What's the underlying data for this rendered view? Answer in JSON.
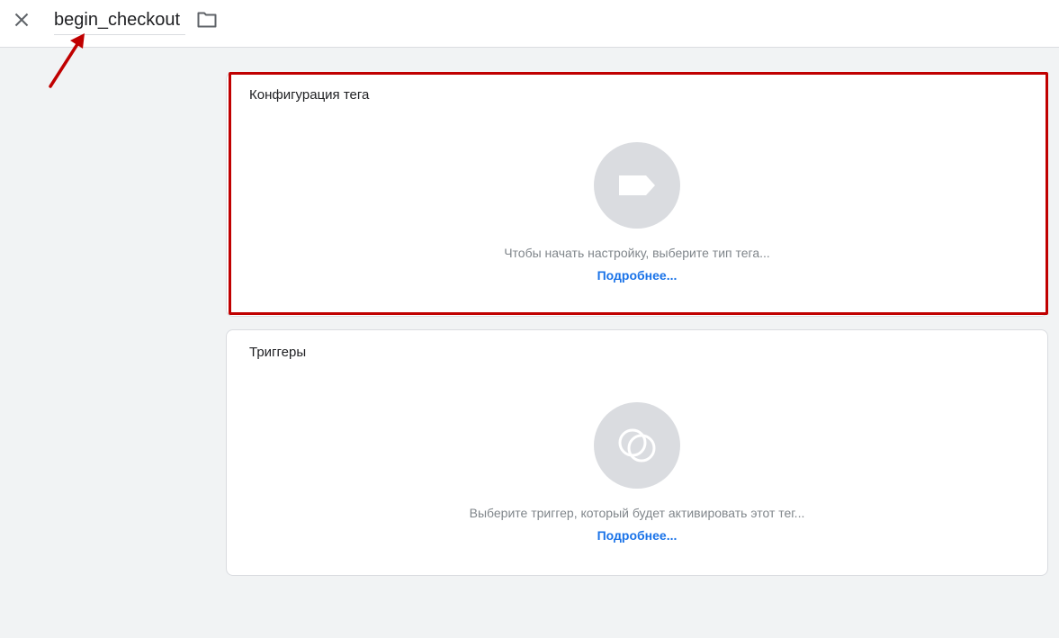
{
  "header": {
    "tag_name": "begin_checkout",
    "close_icon": "close-icon",
    "folder_icon": "folder-icon"
  },
  "tag_config": {
    "title": "Конфигурация тега",
    "icon": "tag-icon",
    "hint": "Чтобы начать настройку, выберите тип тега...",
    "link": "Подробнее..."
  },
  "triggers": {
    "title": "Триггеры",
    "icon": "trigger-icon",
    "hint": "Выберите триггер, который будет активировать этот тег...",
    "link": "Подробнее..."
  },
  "colors": {
    "background": "#f1f3f4",
    "card": "#ffffff",
    "highlight": "#c00000",
    "link": "#1a73e8",
    "icon_circle": "#dadce0",
    "annotation_arrow": "#c00000"
  }
}
